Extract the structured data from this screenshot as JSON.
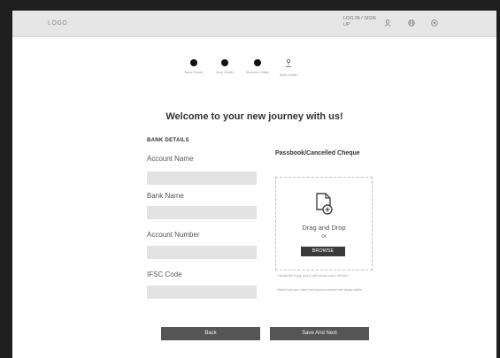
{
  "header": {
    "logo": "LOGO",
    "login": "LOG IN / SIGN UP",
    "icons": [
      "user-icon",
      "globe-icon",
      "settings-icon"
    ]
  },
  "stepper": [
    {
      "label": "Basic Details",
      "completed": true
    },
    {
      "label": "Shop Details",
      "completed": true
    },
    {
      "label": "Business Details",
      "completed": true
    },
    {
      "label": "Bank Details",
      "completed": false
    }
  ],
  "title": "Welcome to your new journey with us!",
  "form": {
    "section": "BANK DETAILS",
    "account_name": {
      "label": "Account Name",
      "value": ""
    },
    "bank_name": {
      "label": "Bank Name",
      "value": ""
    },
    "account_number": {
      "label": "Account Number",
      "value": ""
    },
    "ifsc": {
      "label": "IFSC Code",
      "value": ""
    }
  },
  "upload": {
    "label": "Passbook/Cancelled Cheque",
    "drag": "Drag and Drop",
    "or": "or",
    "browse": "BROWSE",
    "note1": "*Upload file in jpg, png or pdf format, max 2 MB size",
    "note2": "*Make sure your name and account number are clearly visible"
  },
  "buttons": {
    "back": "Back",
    "save": "Save And Next"
  }
}
